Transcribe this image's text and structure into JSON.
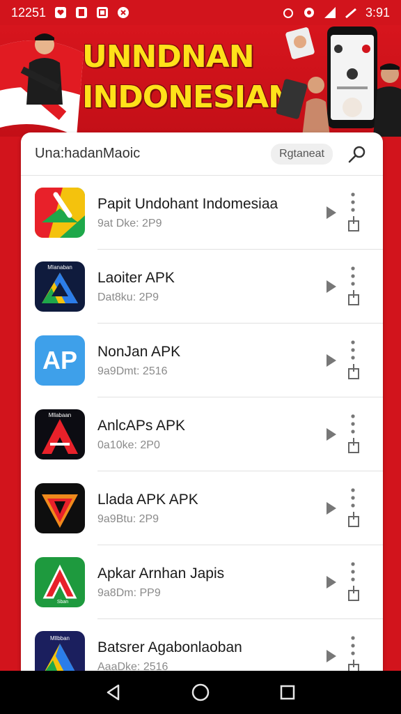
{
  "status_bar": {
    "time_left": "12251",
    "time_right": "3:91"
  },
  "banner": {
    "title_line1": "UNNDNAN",
    "title_line2": "INDONESIAN"
  },
  "card": {
    "title": "Una:hadanMaoic",
    "chip": "Rgtaneat"
  },
  "apps": [
    {
      "name": "Papit Undohant Indomesiaa",
      "meta": "9at Dke: 2P9",
      "icon": "app-icon-1"
    },
    {
      "name": "Laoiter APK",
      "meta": "Dat8ku: 2P9",
      "icon": "app-icon-2"
    },
    {
      "name": "NonJan APK",
      "meta": "9a9Dmt: 2516",
      "icon": "app-icon-3"
    },
    {
      "name": "AnlcAPs APK",
      "meta": "0a10ke: 2P0",
      "icon": "app-icon-4"
    },
    {
      "name": "Llada APK APK",
      "meta": "9a9Btu: 2P9",
      "icon": "app-icon-5"
    },
    {
      "name": "Apkar Arnhan Japis",
      "meta": "9a8Dm: PP9",
      "icon": "app-icon-6"
    },
    {
      "name": "Batsrer Agabonlaoban",
      "meta": "AaaDke: 2516",
      "icon": "app-icon-7"
    }
  ],
  "icon_labels": {
    "icon2": "MIanaban",
    "icon3": "AP",
    "icon4": "Mllabaan",
    "icon6": "Sban",
    "icon7": "Mllbban"
  },
  "colors": {
    "brand_red": "#d2141c",
    "title_yellow": "#ffe11a"
  }
}
